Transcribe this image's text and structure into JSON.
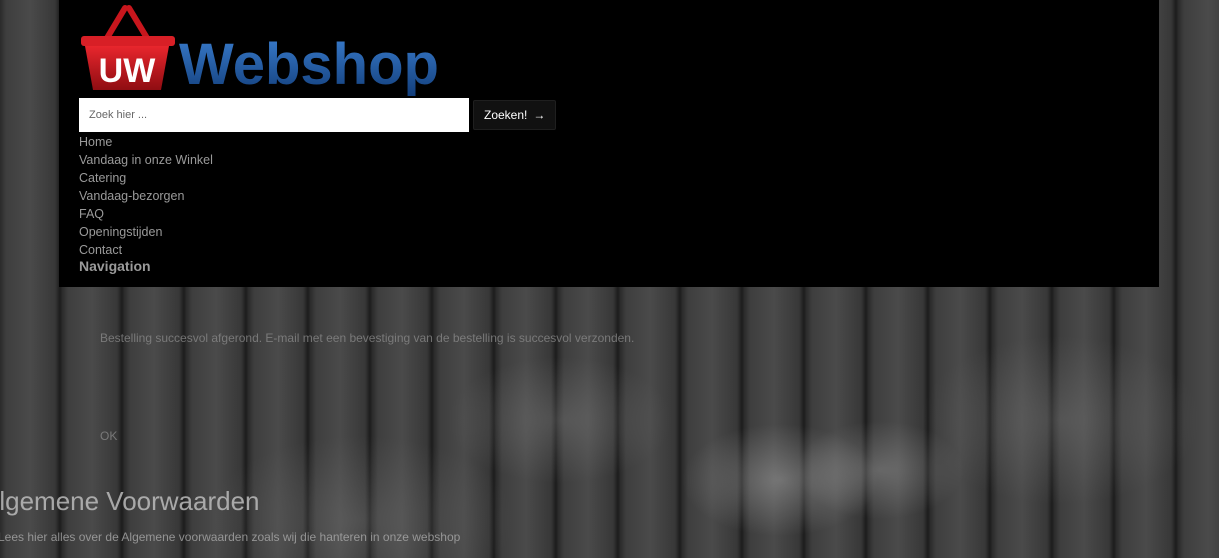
{
  "logo": {
    "badge": "UW",
    "wordmark": "Webshop"
  },
  "search": {
    "placeholder": "Zoek hier ...",
    "button_label": "Zoeken!",
    "button_arrow": "→"
  },
  "nav": {
    "items": [
      {
        "label": "Home"
      },
      {
        "label": "Vandaag in onze Winkel"
      },
      {
        "label": "Catering"
      },
      {
        "label": "Vandaag-bezorgen"
      },
      {
        "label": "FAQ"
      },
      {
        "label": "Openingstijden"
      },
      {
        "label": "Contact"
      }
    ],
    "heading": "Navigation"
  },
  "notice": {
    "message": "Bestelling succesvol afgerond. E-mail met een bevestiging van de bestelling is succesvol verzonden.",
    "ok_label": "OK"
  },
  "page": {
    "title": "Algemene Voorwaarden",
    "subtitle": "Lees hier alles over de Algemene voorwaarden zoals wij die hanteren in onze webshop"
  },
  "colors": {
    "header_bg": "#000000",
    "logo_blue": "#1e5aa8",
    "basket_red": "#c8161d"
  }
}
